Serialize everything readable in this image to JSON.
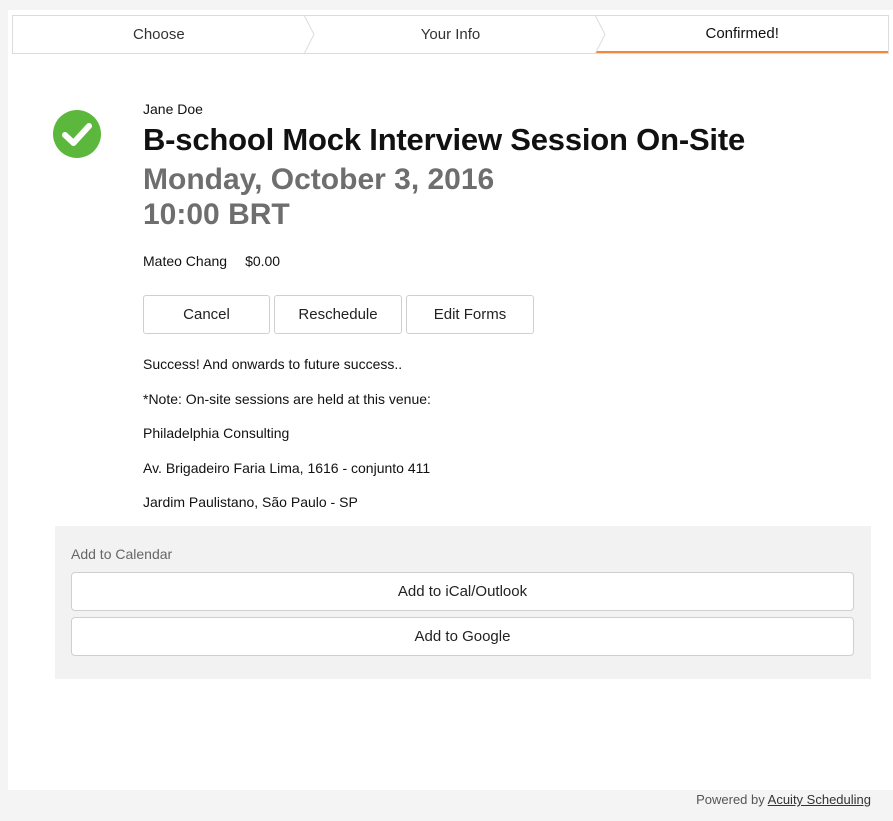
{
  "steps": [
    {
      "label": "Choose"
    },
    {
      "label": "Your Info"
    },
    {
      "label": "Confirmed!"
    }
  ],
  "appointment": {
    "attendee": "Jane Doe",
    "title": "B-school Mock Interview Session On-Site",
    "date": "Monday, October 3, 2016",
    "time": "10:00 BRT",
    "calendar_owner": "Mateo Chang",
    "price": "$0.00"
  },
  "actions": {
    "cancel_label": "Cancel",
    "reschedule_label": "Reschedule",
    "edit_forms_label": "Edit Forms"
  },
  "notes": [
    "Success! And onwards to future success..",
    "*Note: On-site sessions are held at this venue:",
    "Philadelphia Consulting",
    "Av. Brigadeiro Faria Lima, 1616 - conjunto 411",
    "Jardim Paulistano, São Paulo - SP"
  ],
  "calendar": {
    "label": "Add to Calendar",
    "ical_label": "Add to iCal/Outlook",
    "google_label": "Add to Google"
  },
  "footer": {
    "prefix": "Powered by",
    "link_text": "Acuity Scheduling"
  },
  "colors": {
    "success_green": "#5cb83c",
    "active_step_accent": "#f08a3a"
  },
  "icons": {
    "status": "check-circle-icon"
  }
}
